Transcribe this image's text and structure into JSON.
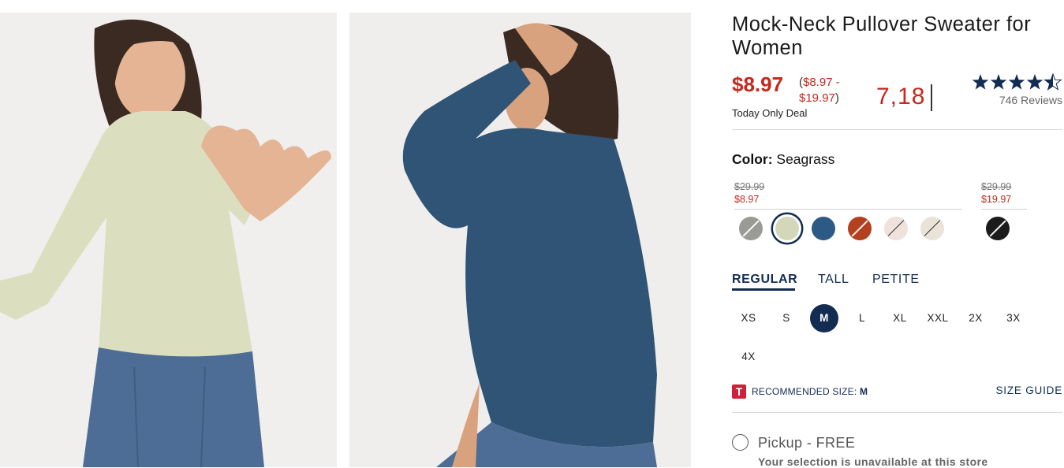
{
  "product": {
    "title": "Mock-Neck Pullover Sweater for Women",
    "price": "$8.97",
    "price_range": "$8.97 - $19.97",
    "price_range_open": "(",
    "price_range_close": ")",
    "deal_label": "Today Only Deal",
    "counter": "7,18",
    "rating": 4.5,
    "reviews_label": "746 Reviews"
  },
  "color": {
    "label": "Color:",
    "selected": "Seagrass",
    "price_groups": [
      {
        "old": "$29.99",
        "new": "$8.97"
      },
      {
        "old": "$29.99",
        "new": "$19.97"
      }
    ],
    "swatches": [
      {
        "name": "gray",
        "hex": "#9a9a97",
        "unavailable": true,
        "selected": false
      },
      {
        "name": "seagrass",
        "hex": "#d4d8bb",
        "unavailable": false,
        "selected": true
      },
      {
        "name": "blue",
        "hex": "#2d5a84",
        "unavailable": false,
        "selected": false
      },
      {
        "name": "rust",
        "hex": "#b3401f",
        "unavailable": true,
        "selected": false
      },
      {
        "name": "blush",
        "hex": "#efe1dc",
        "unavailable": true,
        "selected": false
      },
      {
        "name": "oatmeal",
        "hex": "#e9e3d8",
        "unavailable": true,
        "selected": false
      },
      {
        "name": "black",
        "hex": "#1b1b1b",
        "unavailable": true,
        "selected": false
      }
    ]
  },
  "fit_tabs": [
    {
      "label": "REGULAR",
      "active": true
    },
    {
      "label": "TALL",
      "active": false
    },
    {
      "label": "PETITE",
      "active": false
    }
  ],
  "sizes": [
    "XS",
    "S",
    "M",
    "L",
    "XL",
    "XXL",
    "2X",
    "3X",
    "4X"
  ],
  "selected_size": "M",
  "recommended": {
    "badge": "T",
    "label": "RECOMMENDED SIZE:",
    "size": "M"
  },
  "size_guide": "SIZE GUIDE",
  "pickup": {
    "label": "Pickup - FREE",
    "note": "Your selection is unavailable at this store"
  },
  "colors": {
    "sale_red": "#c7271c",
    "navy": "#122c52"
  }
}
